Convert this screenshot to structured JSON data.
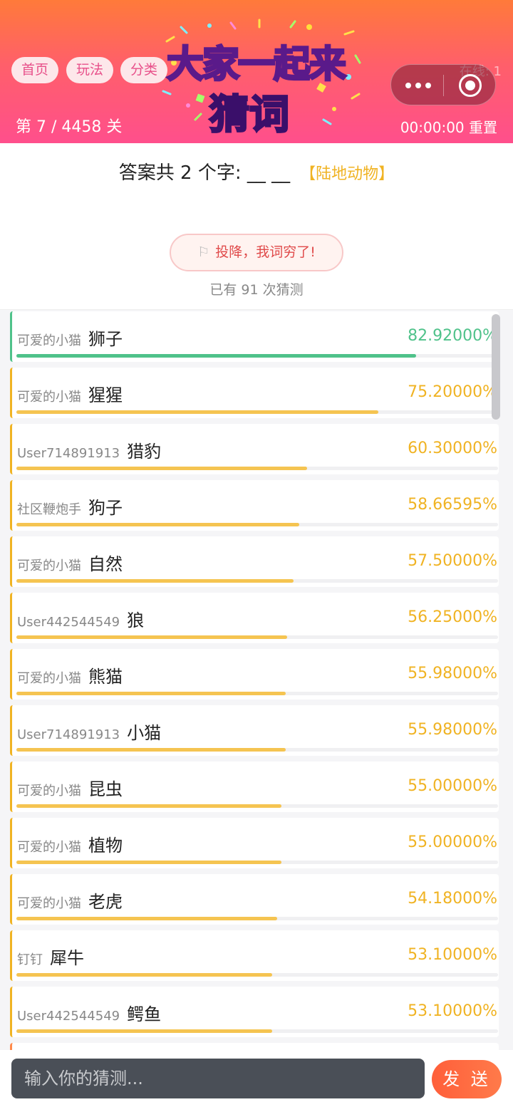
{
  "header": {
    "nav": [
      "首页",
      "玩法",
      "分类"
    ],
    "level_text": "第 7 / 4458 关",
    "online_text": "在线: 1",
    "timer_text": "00:00:00 重置",
    "logo_line1": "大家一起来",
    "logo_line2": "猜词"
  },
  "question": {
    "prompt": "答案共 2 个字: __ __",
    "category": "【陆地动物】"
  },
  "surrender": {
    "label": "投降，我词穷了!"
  },
  "guess_count": "已有 91 次猜测",
  "guesses": [
    {
      "user": "可爱的小猫",
      "word": "狮子",
      "percent": "82.92000%",
      "value": 82.92
    },
    {
      "user": "可爱的小猫",
      "word": "猩猩",
      "percent": "75.20000%",
      "value": 75.2
    },
    {
      "user": "User714891913",
      "word": "猎豹",
      "percent": "60.30000%",
      "value": 60.3
    },
    {
      "user": "社区鞭炮手",
      "word": "狗子",
      "percent": "58.66595%",
      "value": 58.66595
    },
    {
      "user": "可爱的小猫",
      "word": "自然",
      "percent": "57.50000%",
      "value": 57.5
    },
    {
      "user": "User442544549",
      "word": "狼",
      "percent": "56.25000%",
      "value": 56.25
    },
    {
      "user": "可爱的小猫",
      "word": "熊猫",
      "percent": "55.98000%",
      "value": 55.98
    },
    {
      "user": "User714891913",
      "word": "小猫",
      "percent": "55.98000%",
      "value": 55.98
    },
    {
      "user": "可爱的小猫",
      "word": "昆虫",
      "percent": "55.00000%",
      "value": 55.0
    },
    {
      "user": "可爱的小猫",
      "word": "植物",
      "percent": "55.00000%",
      "value": 55.0
    },
    {
      "user": "可爱的小猫",
      "word": "老虎",
      "percent": "54.18000%",
      "value": 54.18
    },
    {
      "user": "钉钉",
      "word": "犀牛",
      "percent": "53.10000%",
      "value": 53.1
    },
    {
      "user": "User442544549",
      "word": "鳄鱼",
      "percent": "53.10000%",
      "value": 53.1
    }
  ],
  "input": {
    "placeholder": "输入你的猜测..."
  },
  "send_label": "发 送",
  "colors": {
    "top_accent": "#4fc28a",
    "accent": "#f0b323",
    "header_start": "#ff7a3a",
    "header_end": "#ff4f8c"
  }
}
